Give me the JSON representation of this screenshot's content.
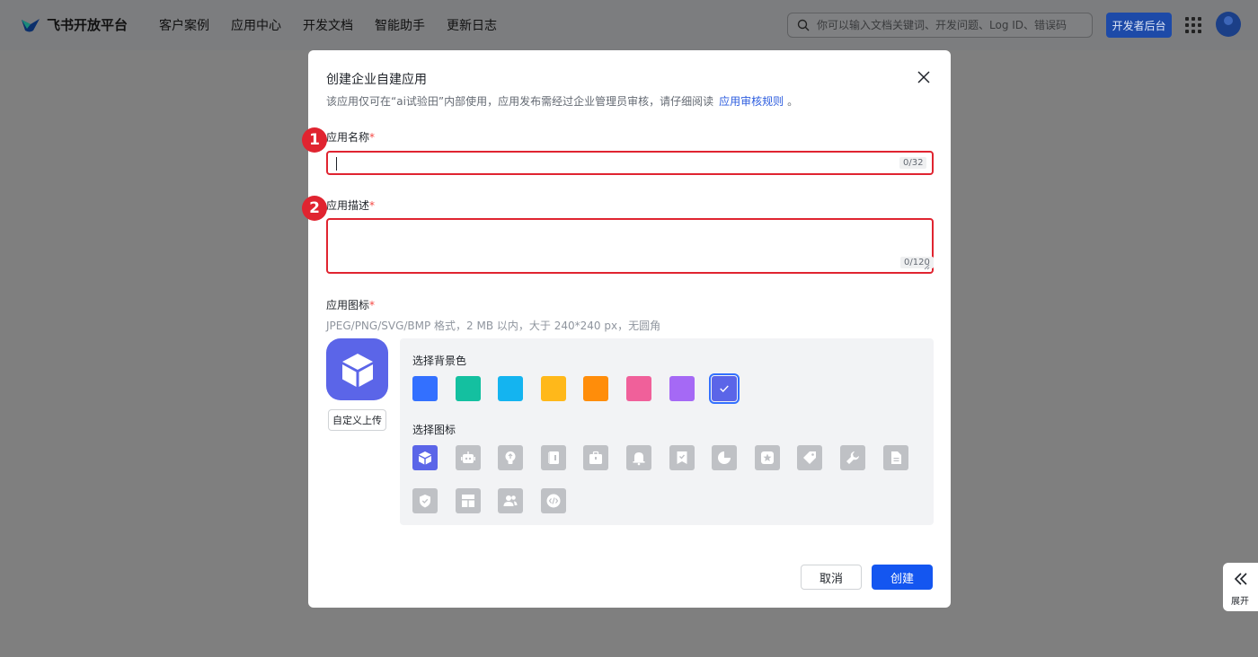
{
  "header": {
    "logo_text": "飞书开放平台",
    "nav": [
      "客户案例",
      "应用中心",
      "开发文档",
      "智能助手",
      "更新日志"
    ],
    "search_placeholder": "你可以输入文档关键词、开发问题、Log ID、错误码",
    "dev_console_label": "开发者后台"
  },
  "modal": {
    "title": "创建企业自建应用",
    "subtitle_prefix": "该应用仅可在“ai试验田”内部使用，应用发布需经过企业管理员审核，请仔细阅读",
    "subtitle_link": "应用审核规则",
    "subtitle_suffix": "。",
    "name_label": "应用名称",
    "name_value": "",
    "name_counter": "0/32",
    "desc_label": "应用描述",
    "desc_value": "",
    "desc_counter": "0/120",
    "required_mark": "*",
    "icon_label": "应用图标",
    "icon_hint": "JPEG/PNG/SVG/BMP 格式，2 MB 以内，大于 240*240 px，无圆角",
    "upload_label": "自定义上传",
    "bg_label": "选择背景色",
    "bg_colors": [
      "#3370ff",
      "#14c0a0",
      "#14b4f0",
      "#ffb81a",
      "#ff8d0a",
      "#f0609a",
      "#a569f5",
      "#5b65e8"
    ],
    "bg_selected_index": 7,
    "choose_icon_label": "选择图标",
    "icons": [
      "cube-icon",
      "robot-icon",
      "lightbulb-icon",
      "book-icon",
      "briefcase-icon",
      "bell-icon",
      "bookmark-check-icon",
      "pie-chart-icon",
      "star-icon",
      "tag-icon",
      "wrench-icon",
      "document-icon",
      "shield-check-icon",
      "layout-icon",
      "users-icon",
      "code-icon"
    ],
    "icon_selected_index": 0,
    "cancel_label": "取消",
    "create_label": "创建"
  },
  "annotations": {
    "badge_1": "1",
    "badge_2": "2"
  },
  "side": {
    "expand_label": "展开"
  },
  "colors": {
    "accent": "#1456f0",
    "highlight_red": "#e02430",
    "icon_bg": "#5b65e8"
  }
}
